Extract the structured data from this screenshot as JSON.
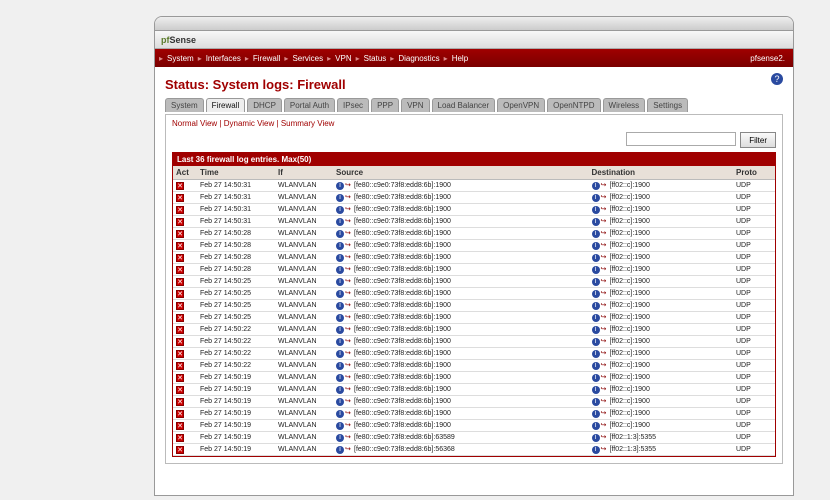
{
  "logo": {
    "prefix": "pf",
    "suffix": "Sense"
  },
  "nav": {
    "items": [
      "System",
      "Interfaces",
      "Firewall",
      "Services",
      "VPN",
      "Status",
      "Diagnostics",
      "Help"
    ],
    "hostname": "pfsense2."
  },
  "page_title": "Status: System logs: Firewall",
  "tabs": [
    "System",
    "Firewall",
    "DHCP",
    "Portal Auth",
    "IPsec",
    "PPP",
    "VPN",
    "Load Balancer",
    "OpenVPN",
    "OpenNTPD",
    "Wireless",
    "Settings"
  ],
  "active_tab": 1,
  "view_links": [
    "Normal View",
    "Dynamic View",
    "Summary View"
  ],
  "filter": {
    "placeholder": "",
    "button": "Filter"
  },
  "table": {
    "caption": "Last 36 firewall log entries. Max(50)",
    "columns": [
      "Act",
      "Time",
      "If",
      "Source",
      "Destination",
      "Proto"
    ],
    "rows": [
      {
        "time": "Feb 27 14:50:31",
        "if": "WLANVLAN",
        "src": "[fe80::c9e0:73f8:edd8:6b]:1900",
        "dst": "[ff02::c]:1900",
        "proto": "UDP"
      },
      {
        "time": "Feb 27 14:50:31",
        "if": "WLANVLAN",
        "src": "[fe80::c9e0:73f8:edd8:6b]:1900",
        "dst": "[ff02::c]:1900",
        "proto": "UDP"
      },
      {
        "time": "Feb 27 14:50:31",
        "if": "WLANVLAN",
        "src": "[fe80::c9e0:73f8:edd8:6b]:1900",
        "dst": "[ff02::c]:1900",
        "proto": "UDP"
      },
      {
        "time": "Feb 27 14:50:31",
        "if": "WLANVLAN",
        "src": "[fe80::c9e0:73f8:edd8:6b]:1900",
        "dst": "[ff02::c]:1900",
        "proto": "UDP"
      },
      {
        "time": "Feb 27 14:50:28",
        "if": "WLANVLAN",
        "src": "[fe80::c9e0:73f8:edd8:6b]:1900",
        "dst": "[ff02::c]:1900",
        "proto": "UDP"
      },
      {
        "time": "Feb 27 14:50:28",
        "if": "WLANVLAN",
        "src": "[fe80::c9e0:73f8:edd8:6b]:1900",
        "dst": "[ff02::c]:1900",
        "proto": "UDP"
      },
      {
        "time": "Feb 27 14:50:28",
        "if": "WLANVLAN",
        "src": "[fe80::c9e0:73f8:edd8:6b]:1900",
        "dst": "[ff02::c]:1900",
        "proto": "UDP"
      },
      {
        "time": "Feb 27 14:50:28",
        "if": "WLANVLAN",
        "src": "[fe80::c9e0:73f8:edd8:6b]:1900",
        "dst": "[ff02::c]:1900",
        "proto": "UDP"
      },
      {
        "time": "Feb 27 14:50:25",
        "if": "WLANVLAN",
        "src": "[fe80::c9e0:73f8:edd8:6b]:1900",
        "dst": "[ff02::c]:1900",
        "proto": "UDP"
      },
      {
        "time": "Feb 27 14:50:25",
        "if": "WLANVLAN",
        "src": "[fe80::c9e0:73f8:edd8:6b]:1900",
        "dst": "[ff02::c]:1900",
        "proto": "UDP"
      },
      {
        "time": "Feb 27 14:50:25",
        "if": "WLANVLAN",
        "src": "[fe80::c9e0:73f8:edd8:6b]:1900",
        "dst": "[ff02::c]:1900",
        "proto": "UDP"
      },
      {
        "time": "Feb 27 14:50:25",
        "if": "WLANVLAN",
        "src": "[fe80::c9e0:73f8:edd8:6b]:1900",
        "dst": "[ff02::c]:1900",
        "proto": "UDP"
      },
      {
        "time": "Feb 27 14:50:22",
        "if": "WLANVLAN",
        "src": "[fe80::c9e0:73f8:edd8:6b]:1900",
        "dst": "[ff02::c]:1900",
        "proto": "UDP"
      },
      {
        "time": "Feb 27 14:50:22",
        "if": "WLANVLAN",
        "src": "[fe80::c9e0:73f8:edd8:6b]:1900",
        "dst": "[ff02::c]:1900",
        "proto": "UDP"
      },
      {
        "time": "Feb 27 14:50:22",
        "if": "WLANVLAN",
        "src": "[fe80::c9e0:73f8:edd8:6b]:1900",
        "dst": "[ff02::c]:1900",
        "proto": "UDP"
      },
      {
        "time": "Feb 27 14:50:22",
        "if": "WLANVLAN",
        "src": "[fe80::c9e0:73f8:edd8:6b]:1900",
        "dst": "[ff02::c]:1900",
        "proto": "UDP"
      },
      {
        "time": "Feb 27 14:50:19",
        "if": "WLANVLAN",
        "src": "[fe80::c9e0:73f8:edd8:6b]:1900",
        "dst": "[ff02::c]:1900",
        "proto": "UDP"
      },
      {
        "time": "Feb 27 14:50:19",
        "if": "WLANVLAN",
        "src": "[fe80::c9e0:73f8:edd8:6b]:1900",
        "dst": "[ff02::c]:1900",
        "proto": "UDP"
      },
      {
        "time": "Feb 27 14:50:19",
        "if": "WLANVLAN",
        "src": "[fe80::c9e0:73f8:edd8:6b]:1900",
        "dst": "[ff02::c]:1900",
        "proto": "UDP"
      },
      {
        "time": "Feb 27 14:50:19",
        "if": "WLANVLAN",
        "src": "[fe80::c9e0:73f8:edd8:6b]:1900",
        "dst": "[ff02::c]:1900",
        "proto": "UDP"
      },
      {
        "time": "Feb 27 14:50:19",
        "if": "WLANVLAN",
        "src": "[fe80::c9e0:73f8:edd8:6b]:1900",
        "dst": "[ff02::c]:1900",
        "proto": "UDP"
      },
      {
        "time": "Feb 27 14:50:19",
        "if": "WLANVLAN",
        "src": "[fe80::c9e0:73f8:edd8:6b]:63589",
        "dst": "[ff02::1:3]:5355",
        "proto": "UDP"
      },
      {
        "time": "Feb 27 14:50:19",
        "if": "WLANVLAN",
        "src": "[fe80::c9e0:73f8:edd8:6b]:56368",
        "dst": "[ff02::1:3]:5355",
        "proto": "UDP"
      }
    ]
  }
}
